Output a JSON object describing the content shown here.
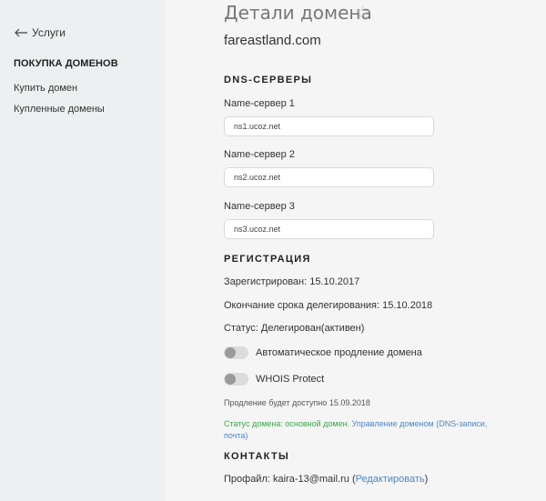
{
  "sidebar": {
    "back_label": "Услуги",
    "section_heading": "ПОКУПКА ДОМЕНОВ",
    "items": [
      {
        "label": "Купить домен"
      },
      {
        "label": "Купленные домены"
      }
    ]
  },
  "page": {
    "title": "Детали домена",
    "star_icon": "star-outline-icon",
    "domain": "fareastland.com"
  },
  "dns": {
    "title": "DNS-СЕРВЕРЫ",
    "servers": [
      {
        "label": "Name-сервер 1",
        "value": "ns1.ucoz.net"
      },
      {
        "label": "Name-сервер 2",
        "value": "ns2.ucoz.net"
      },
      {
        "label": "Name-сервер 3",
        "value": "ns3.ucoz.net"
      }
    ]
  },
  "registration": {
    "title": "РЕГИСТРАЦИЯ",
    "registered": "Зарегистрирован: 15.10.2017",
    "expires": "Окончание срока делегирования: 15.10.2018",
    "status": "Статус: Делегирован(активен)",
    "auto_renew_label": "Автоматическое продление домена",
    "auto_renew_on": false,
    "whois_label": "WHOIS Protect",
    "whois_on": false,
    "renew_note": "Продление будет доступно 15.09.2018",
    "status_text": "Статус домена: основной домен.",
    "manage_link": "Управление доменом (DNS-записи, почта)"
  },
  "contacts": {
    "title": "КОНТАКТЫ",
    "profile_prefix": "Профайл: kaira-13@mail.ru (",
    "edit_link": "Редактировать",
    "profile_suffix": ")"
  },
  "colors": {
    "sidebar_bg": "#edf0f1",
    "main_bg": "#f5f5f5",
    "green": "#39a84a",
    "link": "#4a86c6"
  }
}
